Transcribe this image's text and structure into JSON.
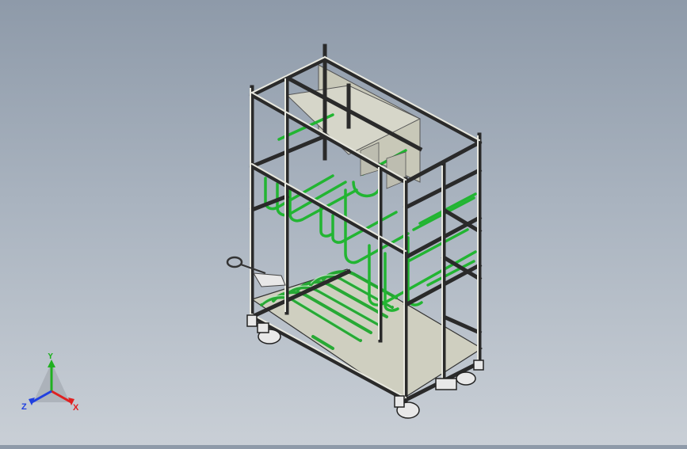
{
  "viewport": {
    "background_top": "#8e9aa9",
    "background_bottom": "#c9cfd6",
    "frame_color": "#d9d9d0",
    "frame_edge": "#2a2a2a",
    "panel_color": "#cfcfc3",
    "pipe_color": "#2ecc40"
  },
  "triad": {
    "x_label": "X",
    "y_label": "Y",
    "z_label": "Z",
    "x_color": "#e02020",
    "y_color": "#20b020",
    "z_color": "#2040e0"
  }
}
